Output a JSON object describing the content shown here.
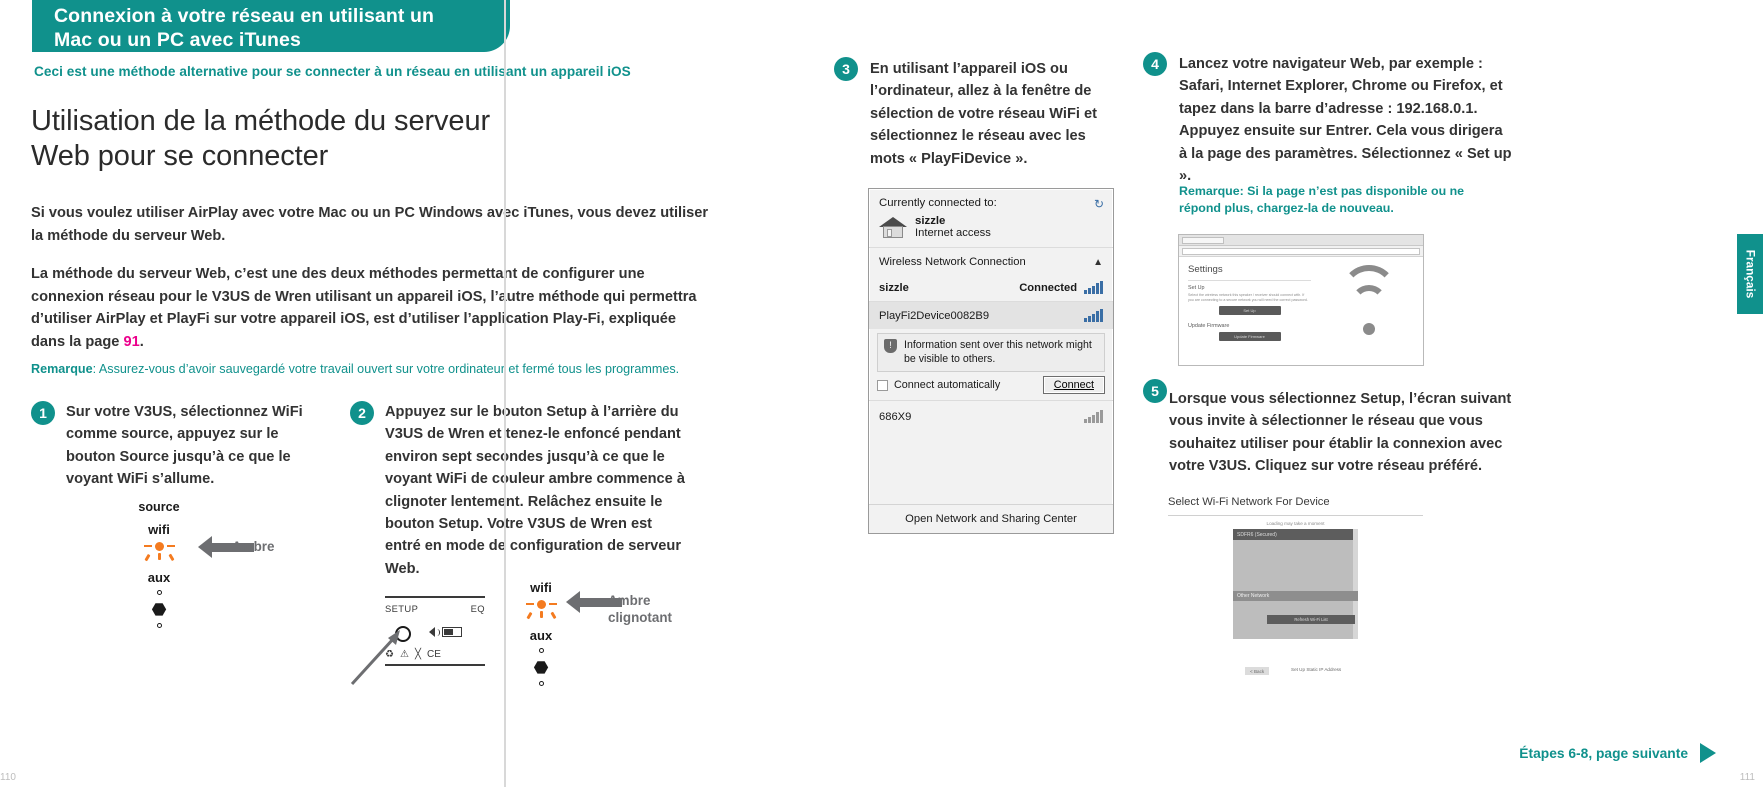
{
  "banner": {
    "line1": "Connexion à votre réseau en utilisant un",
    "line2": "Mac ou un PC avec iTunes",
    "color": "#10918c"
  },
  "subtitle": "Ceci est une méthode alternative pour se connecter à un réseau en utilisant un appareil iOS",
  "heading": {
    "line1": "Utilisation de la méthode du serveur",
    "line2": "Web pour se connecter"
  },
  "paragraphs": {
    "p1": "Si vous voulez utiliser AirPlay avec votre Mac ou un PC Windows avec iTunes, vous devez utiliser la méthode du serveur Web.",
    "p2_before": "La méthode du serveur Web, c’est une des deux méthodes permettant de configurer une connexion réseau pour le V3US de Wren utilisant un appareil iOS, l’autre méthode qui permettra d’utiliser AirPlay et PlayFi sur votre appareil iOS, est d’utiliser l’application Play-Fi, expliquée dans la page ",
    "p2_page": "91",
    "p2_after": "."
  },
  "note1": {
    "label": "Remarque",
    "text": ": Assurez-vous d’avoir sauvegardé votre travail ouvert sur votre ordinateur et fermé tous les programmes.",
    "color": "#10918c"
  },
  "note2": "Remarque: Si la page n’est pas disponible ou ne répond plus, chargez-la de nouveau.",
  "steps": [
    {
      "num": "1",
      "text": "Sur votre V3US, sélectionnez WiFi comme source, appuyez sur le bouton Source jusqu’à ce que le voyant WiFi s’allume."
    },
    {
      "num": "2",
      "text": "Appuyez sur le bouton Setup à l’arrière du V3US de Wren et tenez-le enfoncé pendant environ sept secondes jusqu’à ce que le voyant WiFi de couleur ambre commence à clignoter lentement. Relâchez ensuite le bouton Setup. Votre V3US de Wren est entré en mode de configuration de serveur Web."
    },
    {
      "num": "3",
      "text": "En utilisant l’appareil iOS ou l’ordinateur, allez à la fenêtre de sélection de votre réseau WiFi et sélectionnez le réseau avec les mots « PlayFiDevice »."
    },
    {
      "num": "4",
      "text": "Lancez votre navigateur Web, par exemple : Safari, Internet Explorer, Chrome ou Firefox, et tapez dans la barre d’adresse : 192.168.0.1. Appuyez ensuite sur Entrer. Cela vous dirigera à la page des paramètres. Sélectionnez « Set up »."
    },
    {
      "num": "5",
      "text": "Lorsque vous sélectionnez Setup, l’écran suivant vous invite à sélectionner le réseau que vous souhaitez utiliser pour établir la connexion avec votre V3US. Cliquez sur votre réseau préféré."
    }
  ],
  "led_diagram_1": {
    "source": "source",
    "wifi": "wifi",
    "aux": "aux",
    "arrow_label": "Ambre",
    "led_color": "#f47b20"
  },
  "led_diagram_2": {
    "wifi": "wifi",
    "aux": "aux",
    "arrow_label_line1": "Ambre",
    "arrow_label_line2": "clignotant"
  },
  "remote": {
    "setup": "SETUP",
    "eq": "EQ"
  },
  "windows_dialog": {
    "currently_connected": "Currently connected to:",
    "active_network": "sizzle",
    "active_status": "Internet access",
    "section": "Wireless Network Connection",
    "networks": [
      {
        "name": "sizzle",
        "status": "Connected",
        "selected": false
      },
      {
        "name": "PlayFi2Device0082B9",
        "status": "",
        "selected": true
      },
      {
        "name": "686X9",
        "status": "",
        "selected": false
      }
    ],
    "info_line1": "Information sent over this network might",
    "info_line2": "be visible to others.",
    "connect_auto": "Connect automatically",
    "connect_button": "Connect",
    "footer": "Open Network and Sharing Center"
  },
  "browser_screenshot": {
    "title": "Settings",
    "setup_label": "Set Up",
    "blurb": "Select the wireless network this speaker / receiver should connect with. If you are connecting to a secure network you will need the correct password.",
    "setup_button": "Set Up",
    "update_label": "Update Firmware",
    "update_button": "Update Firmware"
  },
  "device_list_screenshot": {
    "title": "Select Wi-Fi Network For Device",
    "loading": "Loading may take a moment",
    "selected_network": "SDFR6 (Secured)",
    "other_network": "Other Network",
    "refresh_button": "Refresh Wi-Fi List",
    "back_button": "< Back",
    "static_ip": "Set Up Static IP Address"
  },
  "footer": {
    "next": "Étapes 6-8, page suivante",
    "language_tab": "Français",
    "page_left": "110",
    "page_right": "111"
  }
}
